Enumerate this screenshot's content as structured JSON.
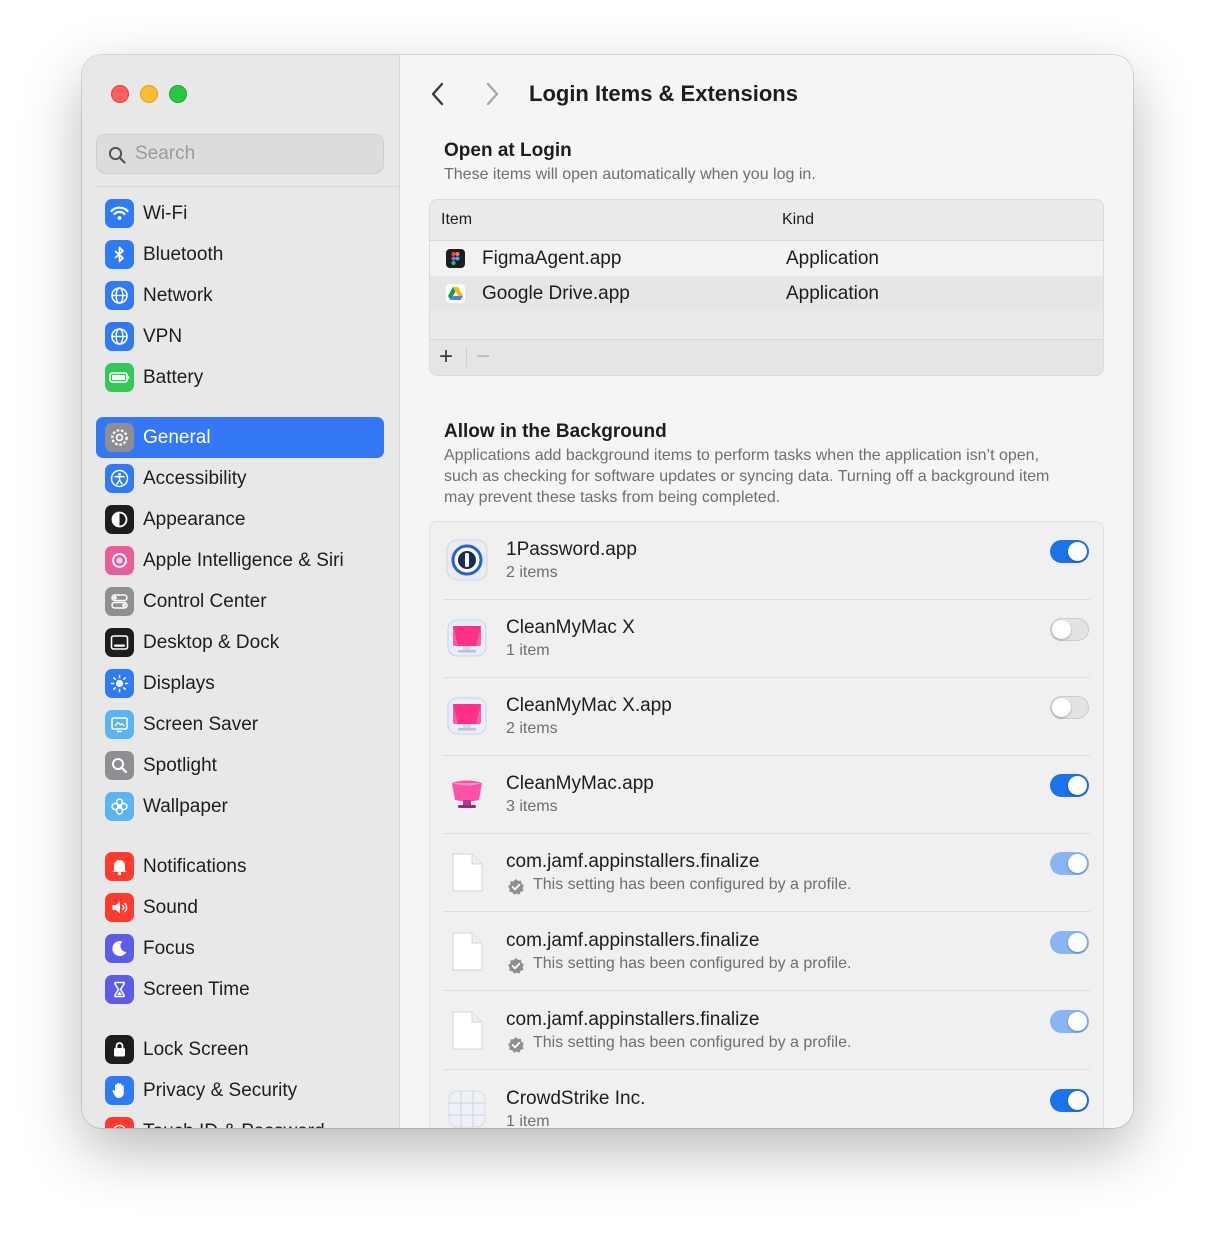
{
  "search": {
    "placeholder": "Search"
  },
  "sidebar": {
    "groups": [
      [
        {
          "label": "Wi-Fi",
          "icon": "wifi-icon",
          "color": "#2f7bf6"
        },
        {
          "label": "Bluetooth",
          "icon": "bluetooth-icon",
          "color": "#2f7bf6"
        },
        {
          "label": "Network",
          "icon": "globe-icon",
          "color": "#2f7bf6"
        },
        {
          "label": "VPN",
          "icon": "vpn-globe-icon",
          "color": "#2f7bf6"
        },
        {
          "label": "Battery",
          "icon": "battery-icon",
          "color": "#34c759"
        }
      ],
      [
        {
          "label": "General",
          "icon": "gear-icon",
          "color": "#8e8e93",
          "active": true
        },
        {
          "label": "Accessibility",
          "icon": "accessibility-icon",
          "color": "#2f7bf6"
        },
        {
          "label": "Appearance",
          "icon": "appearance-icon",
          "color": "#1d1d1f"
        },
        {
          "label": "Apple Intelligence & Siri",
          "icon": "siri-icon",
          "color": "#e85d9c"
        },
        {
          "label": "Control Center",
          "icon": "control-center-icon",
          "color": "#8e8e93"
        },
        {
          "label": "Desktop & Dock",
          "icon": "dock-icon",
          "color": "#1d1d1f"
        },
        {
          "label": "Displays",
          "icon": "sun-icon",
          "color": "#2f7bf6"
        },
        {
          "label": "Screen Saver",
          "icon": "screensaver-icon",
          "color": "#5ab4f0"
        },
        {
          "label": "Spotlight",
          "icon": "magnifier-icon",
          "color": "#8e8e93"
        },
        {
          "label": "Wallpaper",
          "icon": "flower-icon",
          "color": "#5ab4f0"
        }
      ],
      [
        {
          "label": "Notifications",
          "icon": "bell-icon",
          "color": "#ff3b30"
        },
        {
          "label": "Sound",
          "icon": "speaker-icon",
          "color": "#ff3b30"
        },
        {
          "label": "Focus",
          "icon": "moon-icon",
          "color": "#5e5ce6"
        },
        {
          "label": "Screen Time",
          "icon": "hourglass-icon",
          "color": "#5e5ce6"
        }
      ],
      [
        {
          "label": "Lock Screen",
          "icon": "lock-icon",
          "color": "#1d1d1f"
        },
        {
          "label": "Privacy & Security",
          "icon": "hand-icon",
          "color": "#2f7bf6"
        },
        {
          "label": "Touch ID & Password",
          "icon": "fingerprint-icon",
          "color": "#ff3b30"
        }
      ]
    ]
  },
  "header": {
    "title": "Login Items & Extensions"
  },
  "open_at_login": {
    "title": "Open at Login",
    "description": "These items will open automatically when you log in.",
    "columns": {
      "item": "Item",
      "kind": "Kind"
    },
    "rows": [
      {
        "name": "FigmaAgent.app",
        "kind": "Application",
        "icon": "figma-icon"
      },
      {
        "name": "Google Drive.app",
        "kind": "Application",
        "icon": "google-drive-icon"
      }
    ],
    "add_label": "+",
    "remove_label": "−"
  },
  "background": {
    "title": "Allow in the Background",
    "description": "Applications add background items to perform tasks when the application isn’t open, such as checking for software updates or syncing data. Turning off a background item may prevent these tasks from being completed.",
    "items": [
      {
        "name": "1Password.app",
        "sub": "2 items",
        "state": "on",
        "icon": "1password-icon"
      },
      {
        "name": "CleanMyMac X",
        "sub": "1 item",
        "state": "off",
        "icon": "cleanmymac-x-icon"
      },
      {
        "name": "CleanMyMac X.app",
        "sub": "2 items",
        "state": "off",
        "icon": "cleanmymac-x-icon"
      },
      {
        "name": "CleanMyMac.app",
        "sub": "3 items",
        "state": "on",
        "icon": "cleanmymac-icon"
      },
      {
        "name": "com.jamf.appinstallers.finalize",
        "sub": "This setting has been configured by a profile.",
        "state": "managed",
        "icon": "document-icon",
        "profile": true
      },
      {
        "name": "com.jamf.appinstallers.finalize",
        "sub": "This setting has been configured by a profile.",
        "state": "managed",
        "icon": "document-icon",
        "profile": true
      },
      {
        "name": "com.jamf.appinstallers.finalize",
        "sub": "This setting has been configured by a profile.",
        "state": "managed",
        "icon": "document-icon",
        "profile": true
      },
      {
        "name": "CrowdStrike Inc.",
        "sub": "1 item",
        "state": "on",
        "icon": "crowdstrike-icon"
      }
    ]
  },
  "colors": {
    "accent": "#3478f6",
    "toggle_on": "#1a73e8"
  }
}
